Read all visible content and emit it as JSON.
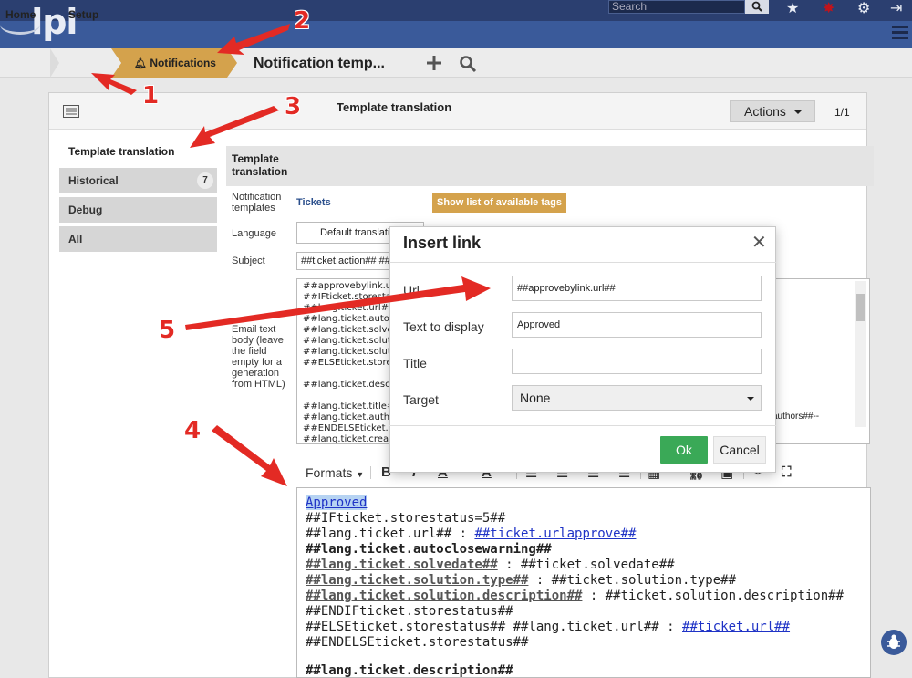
{
  "app": {
    "logo_text": "lpi"
  },
  "topbar": {
    "search_placeholder": "Search"
  },
  "breadcrumb": {
    "home": "Home",
    "setup": "Setup",
    "notifications": "Notifications",
    "page_title": "Notification temp..."
  },
  "panel": {
    "title": "Template translation",
    "actions_label": "Actions",
    "pager": "1/1"
  },
  "tabs": [
    {
      "label": "Template translation"
    },
    {
      "label": "Historical",
      "badge": "7"
    },
    {
      "label": "Debug"
    },
    {
      "label": "All"
    }
  ],
  "form": {
    "header": "Template translation",
    "notification_templates_label": "Notification templates",
    "notification_templates_value": "Tickets",
    "tags_button": "Show list of available tags",
    "language_label": "Language",
    "language_value": "Default translati",
    "subject_label": "Subject",
    "subject_value": "##ticket.action## ##",
    "email_body_label": "Email text body (leave the field empty for a generation from HTML)",
    "text_body_lines": [
      "##approvebylink.url##",
      "##IFticket.storestatu",
      "  ##lang.ticket.url##",
      "  ##lang.ticket.autoclo",
      "  ##lang.ticket.solvedd",
      "  ##lang.ticket.solutio",
      "  ##lang.ticket.solutio",
      "  ##ELSEticket.store",
      "",
      "  ##lang.ticket.descri",
      "",
      "  ##lang.ticket.title##",
      "  ##lang.ticket.autho",
      "##ENDELSEticket.a",
      "  ##lang.ticket.creati"
    ],
    "text_body_tail": "authors##--"
  },
  "editor": {
    "formats_label": "Formats",
    "lines": {
      "l1": "Approved",
      "l2": "##IFticket.storestatus=5##",
      "l3a": "##lang.ticket.url## : ",
      "l3b": "##ticket.urlapprove##",
      "l4": "##lang.ticket.autoclosewarning##",
      "l5a": "##lang.ticket.solvedate##",
      "l5b": " : ##ticket.solvedate##",
      "l6a": "##lang.ticket.solution.type##",
      "l6b": " : ##ticket.solution.type##",
      "l7a": "##lang.ticket.solution.description##",
      "l7b": " : ##ticket.solution.description##",
      "l8": "##ENDIFticket.storestatus##",
      "l9a": "##ELSEticket.storestatus## ##lang.ticket.url## : ",
      "l9b": "##ticket.url##",
      "l10": "##ENDELSEticket.storestatus##",
      "l11": "##lang.ticket.description##"
    }
  },
  "modal": {
    "title": "Insert link",
    "url_label": "Url",
    "url_value": "##approvebylink.url##",
    "text_label": "Text to display",
    "text_value": "Approved",
    "title_label": "Title",
    "title_value": "",
    "target_label": "Target",
    "target_value": "None",
    "ok": "Ok",
    "cancel": "Cancel"
  },
  "annotations": [
    "1",
    "2",
    "3",
    "4",
    "5"
  ],
  "colors": {
    "accent": "#d4a24c",
    "ok": "#3aa957",
    "arrow": "#e32a24",
    "navy": "#2b3f70"
  }
}
